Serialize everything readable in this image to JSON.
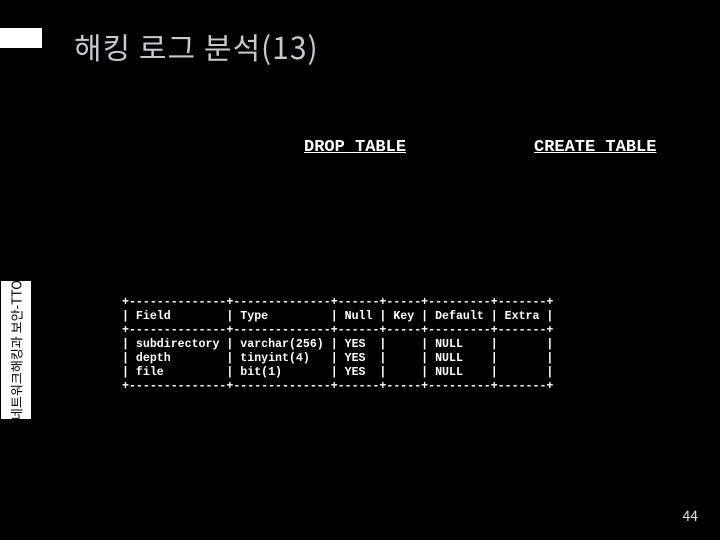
{
  "slide": {
    "title": "해킹 로그 분석(13)",
    "labels": {
      "drop": "DROP TABLE",
      "create": "CREATE TABLE"
    },
    "sidebar_text": "네트워크해킹과 보안-TTO",
    "page_number": "44"
  },
  "terminal": {
    "border_top": "+--------------+--------------+------+-----+---------+-------+",
    "header_row": "| Field        | Type         | Null | Key | Default | Extra |",
    "border_mid": "+--------------+--------------+------+-----+---------+-------+",
    "row1": "| subdirectory | varchar(256) | YES  |     | NULL    |       |",
    "row2": "| depth        | tinyint(4)   | YES  |     | NULL    |       |",
    "row3": "| file         | bit(1)       | YES  |     | NULL    |       |",
    "border_bot": "+--------------+--------------+------+-----+---------+-------+"
  },
  "chart_data": {
    "type": "table",
    "title": "MySQL DESCRIBE output",
    "columns": [
      "Field",
      "Type",
      "Null",
      "Key",
      "Default",
      "Extra"
    ],
    "rows": [
      [
        "subdirectory",
        "varchar(256)",
        "YES",
        "",
        "NULL",
        ""
      ],
      [
        "depth",
        "tinyint(4)",
        "YES",
        "",
        "NULL",
        ""
      ],
      [
        "file",
        "bit(1)",
        "YES",
        "",
        "NULL",
        ""
      ]
    ]
  }
}
